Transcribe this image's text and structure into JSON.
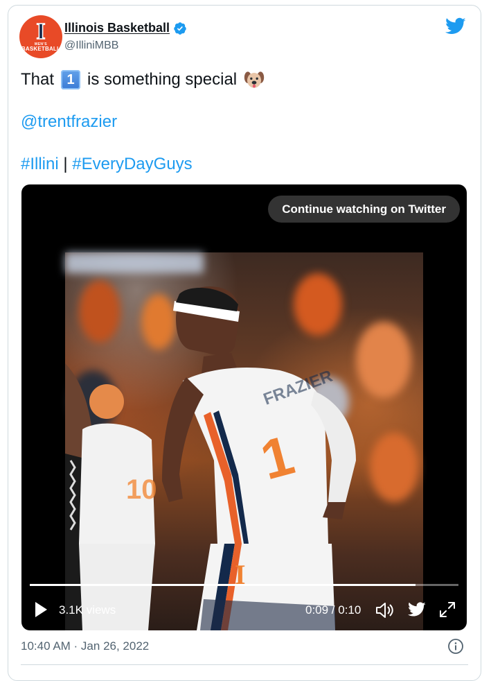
{
  "account": {
    "display_name": "Illinois Basketball",
    "handle": "@IlliniMBB",
    "avatar_mark": "I",
    "avatar_line1": "MEN'S",
    "avatar_line2": "BASKETBALL",
    "verified": true
  },
  "tweet": {
    "text_before": "That",
    "keycap": "1",
    "text_after": "is something special",
    "emoji": "dog-face",
    "mention": "@trentfrazier",
    "hashtag1": "#Illini",
    "separator": "|",
    "hashtag2": "#EveryDayGuys"
  },
  "video": {
    "continue_label": "Continue watching on Twitter",
    "views": "3.1K views",
    "time": "0:09 / 0:10",
    "progress": 0.9,
    "icons": [
      "play-icon",
      "volume-icon",
      "twitter-bird-icon",
      "fullscreen-icon"
    ]
  },
  "footer": {
    "timestamp": "10:40 AM · Jan 26, 2022",
    "info_icon": "info-icon"
  },
  "colors": {
    "link": "#1d9bf0",
    "text": "#0f1419",
    "secondary": "#536471",
    "illini_orange": "#e84a27",
    "illini_blue": "#13294b"
  }
}
